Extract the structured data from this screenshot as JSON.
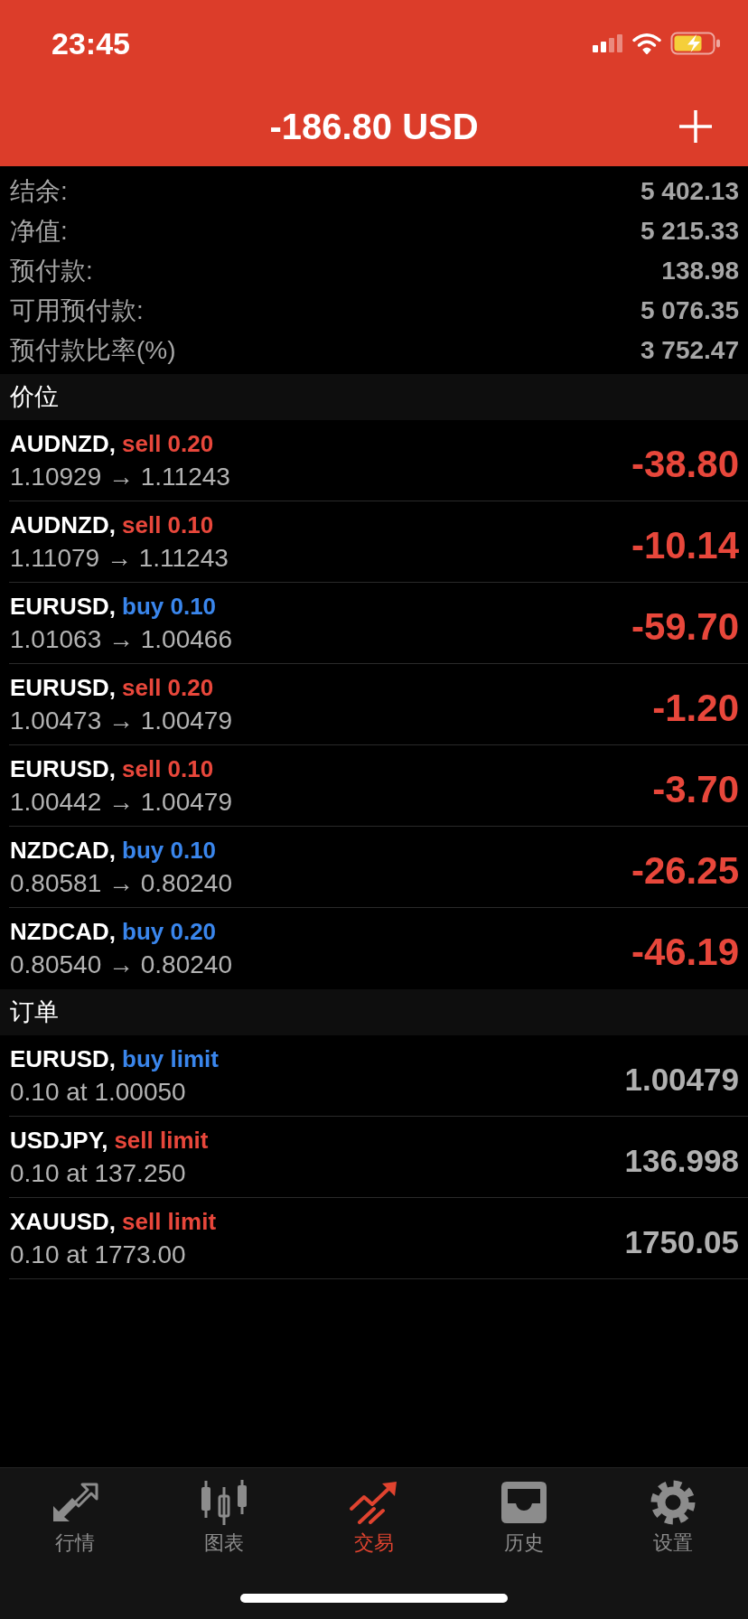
{
  "status_bar": {
    "time": "23:45"
  },
  "header": {
    "title": "-186.80 USD"
  },
  "summary": [
    {
      "label": "结余:",
      "value": "5 402.13"
    },
    {
      "label": "净值:",
      "value": "5 215.33"
    },
    {
      "label": "预付款:",
      "value": "138.98"
    },
    {
      "label": "可用预付款:",
      "value": "5 076.35"
    },
    {
      "label": "预付款比率(%)",
      "value": "3 752.47"
    }
  ],
  "positions": {
    "title": "价位",
    "rows": [
      {
        "symbol": "AUDNZD,",
        "kind": "sell",
        "trade": "sell 0.20",
        "prices": "1.10929 → 1.11243",
        "profit": "-38.80"
      },
      {
        "symbol": "AUDNZD,",
        "kind": "sell",
        "trade": "sell 0.10",
        "prices": "1.11079 → 1.11243",
        "profit": "-10.14"
      },
      {
        "symbol": "EURUSD,",
        "kind": "buy",
        "trade": "buy 0.10",
        "prices": "1.01063 → 1.00466",
        "profit": "-59.70"
      },
      {
        "symbol": "EURUSD,",
        "kind": "sell",
        "trade": "sell 0.20",
        "prices": "1.00473 → 1.00479",
        "profit": "-1.20"
      },
      {
        "symbol": "EURUSD,",
        "kind": "sell",
        "trade": "sell 0.10",
        "prices": "1.00442 → 1.00479",
        "profit": "-3.70"
      },
      {
        "symbol": "NZDCAD,",
        "kind": "buy",
        "trade": "buy 0.10",
        "prices": "0.80581 → 0.80240",
        "profit": "-26.25"
      },
      {
        "symbol": "NZDCAD,",
        "kind": "buy",
        "trade": "buy 0.20",
        "prices": "0.80540 → 0.80240",
        "profit": "-46.19"
      }
    ]
  },
  "orders": {
    "title": "订单",
    "rows": [
      {
        "symbol": "EURUSD,",
        "kind": "buy",
        "trade": "buy limit",
        "detail": "0.10 at 1.00050",
        "price": "1.00479"
      },
      {
        "symbol": "USDJPY,",
        "kind": "sell",
        "trade": "sell limit",
        "detail": "0.10 at 137.250",
        "price": "136.998"
      },
      {
        "symbol": "XAUUSD,",
        "kind": "sell",
        "trade": "sell limit",
        "detail": "0.10 at 1773.00",
        "price": "1750.05"
      }
    ]
  },
  "tabs": [
    {
      "label": "行情",
      "selected": false
    },
    {
      "label": "图表",
      "selected": false
    },
    {
      "label": "交易",
      "selected": true
    },
    {
      "label": "历史",
      "selected": false
    },
    {
      "label": "设置",
      "selected": false
    }
  ]
}
